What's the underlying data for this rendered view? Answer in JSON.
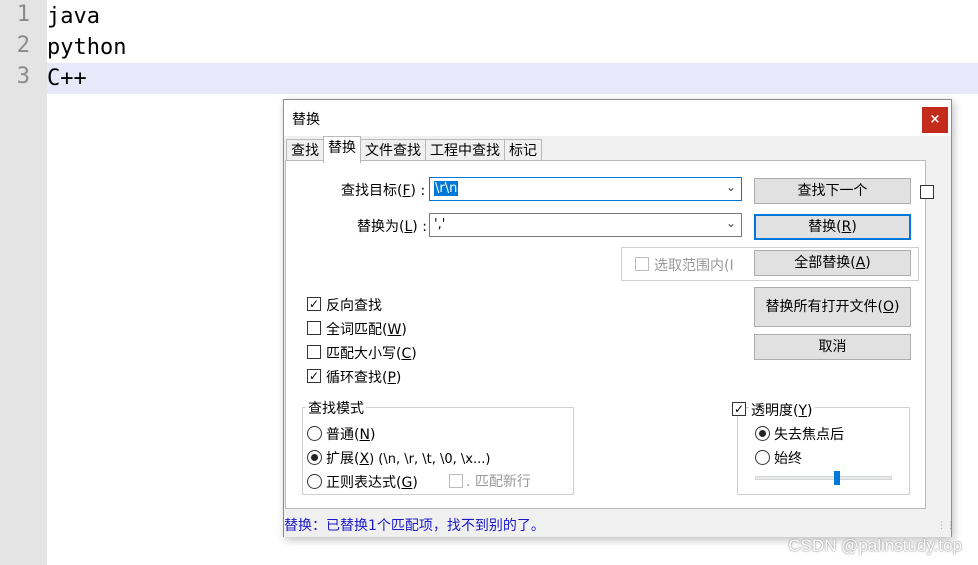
{
  "editor": {
    "lines": [
      {
        "number": "1",
        "text": "java"
      },
      {
        "number": "2",
        "text": "python"
      },
      {
        "number": "3",
        "text": "C++"
      }
    ]
  },
  "dialog": {
    "title": "替换",
    "close_glyph": "×",
    "tabs": [
      "查找",
      "替换",
      "文件查找",
      "工程中查找",
      "标记"
    ],
    "active_tab": "替换",
    "find_label": "查找目标(",
    "find_key": "F",
    "find_label_end": ") :",
    "find_value": "\\r\\n",
    "replace_label": "替换为(",
    "replace_key": "L",
    "replace_label_end": ") :",
    "replace_value": "','",
    "in_selection_label": "选取范围内(I",
    "buttons": {
      "find_next": "查找下一个",
      "replace": "替换(",
      "replace_key": "R",
      "replace_end": ")",
      "replace_all": "全部替换(",
      "replace_all_key": "A",
      "replace_all_end": ")",
      "replace_all_open": "替换所有打开文件(",
      "replace_all_open_key": "O",
      "replace_all_open_end": ")",
      "cancel": "取消"
    },
    "options": {
      "backward": {
        "label": "反向查找",
        "checked": true
      },
      "whole_word": {
        "label": "全词匹配(",
        "key": "W",
        "end": ")",
        "checked": false
      },
      "match_case": {
        "label": "匹配大小写(",
        "key": "C",
        "end": ")",
        "checked": false
      },
      "wrap": {
        "label": "循环查找(",
        "key": "P",
        "end": ")",
        "checked": true
      }
    },
    "search_mode": {
      "title": "查找模式",
      "normal": "普通(",
      "normal_key": "N",
      "normal_end": ")",
      "extended": "扩展(",
      "extended_key": "X",
      "extended_end": ") (\\n, \\r, \\t, \\0, \\x...)",
      "regex": "正则表达式(",
      "regex_key": "G",
      "regex_end": ")",
      "dot_newline": ". 匹配新行",
      "selected": "extended"
    },
    "transparency": {
      "label": "透明度(",
      "key": "Y",
      "end": ")",
      "checked": true,
      "on_lose_focus": "失去焦点后",
      "always": "始终",
      "selected": "on_lose_focus",
      "level": 0.6
    },
    "status": "替换：已替换1个匹配项，找不到别的了。"
  },
  "watermark": "CSDN @palinstudy.top",
  "colors": {
    "accent": "#0078d7",
    "close": "#c42b1c",
    "status_text": "#1a1acc",
    "current_line": "#e8e8fb"
  }
}
